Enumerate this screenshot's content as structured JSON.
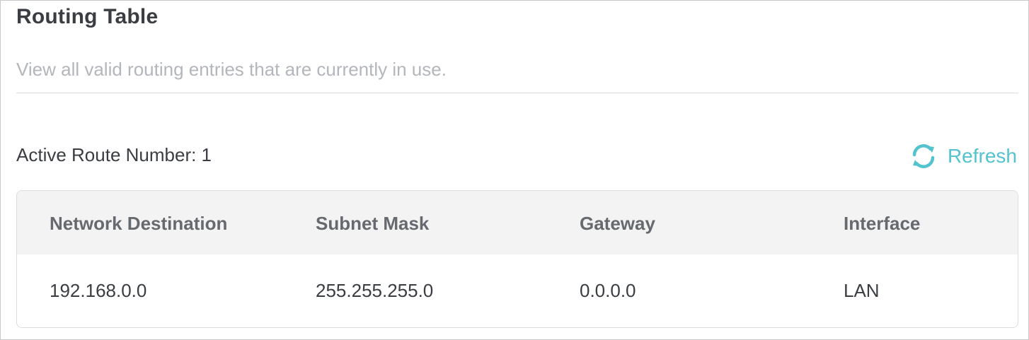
{
  "page": {
    "title": "Routing Table",
    "description": "View all valid routing entries that are currently in use."
  },
  "routes": {
    "active_label": "Active Route Number: 1",
    "refresh_label": "Refresh"
  },
  "table": {
    "headers": [
      "Network Destination",
      "Subnet Mask",
      "Gateway",
      "Interface"
    ],
    "rows": [
      [
        "192.168.0.0",
        "255.255.255.0",
        "0.0.0.0",
        "LAN"
      ]
    ]
  },
  "icons": {
    "refresh": "refresh-icon"
  },
  "colors": {
    "accent": "#52c3cf",
    "title": "#3a3d42",
    "muted": "#b3b6ba",
    "header_bg": "#f3f3f3"
  }
}
